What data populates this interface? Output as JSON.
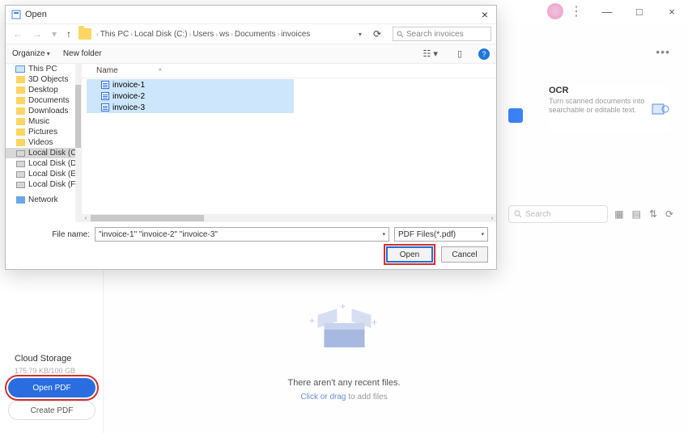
{
  "app_titlebar": {
    "minimize": "—",
    "maximize": "□",
    "close": "×"
  },
  "ocr": {
    "title": "OCR",
    "desc": "Turn scanned documents into searchable or editable text."
  },
  "bg_search": {
    "placeholder": "Search"
  },
  "empty": {
    "title": "There aren't any recent files.",
    "link": "Click or drag",
    "rest": " to add files"
  },
  "cloud": {
    "title": "Cloud Storage",
    "usage": "175.79 KB/100 GB"
  },
  "buttons": {
    "open_pdf": "Open PDF",
    "create_pdf": "Create PDF"
  },
  "dialog": {
    "title": "Open",
    "breadcrumb": [
      "This PC",
      "Local Disk (C:)",
      "Users",
      "ws",
      "Documents",
      "invoices"
    ],
    "search_placeholder": "Search invoices",
    "organize": "Organize",
    "new_folder": "New folder",
    "col_name": "Name",
    "tree": [
      {
        "label": "This PC",
        "icon": "pc"
      },
      {
        "label": "3D Objects",
        "icon": "folder"
      },
      {
        "label": "Desktop",
        "icon": "folder"
      },
      {
        "label": "Documents",
        "icon": "folder"
      },
      {
        "label": "Downloads",
        "icon": "folder"
      },
      {
        "label": "Music",
        "icon": "folder"
      },
      {
        "label": "Pictures",
        "icon": "folder"
      },
      {
        "label": "Videos",
        "icon": "folder"
      },
      {
        "label": "Local Disk (C:)",
        "icon": "drive",
        "selected": true
      },
      {
        "label": "Local Disk (D:)",
        "icon": "drive"
      },
      {
        "label": "Local Disk (E:)",
        "icon": "drive"
      },
      {
        "label": "Local Disk (F:)",
        "icon": "drive"
      },
      {
        "label": "Network",
        "icon": "net"
      }
    ],
    "files": [
      "invoice-1",
      "invoice-2",
      "invoice-3"
    ],
    "filename_label": "File name:",
    "filename_value": "\"invoice-1\" \"invoice-2\" \"invoice-3\"",
    "filter": "PDF Files(*.pdf)",
    "open_btn": "Open",
    "cancel_btn": "Cancel"
  }
}
